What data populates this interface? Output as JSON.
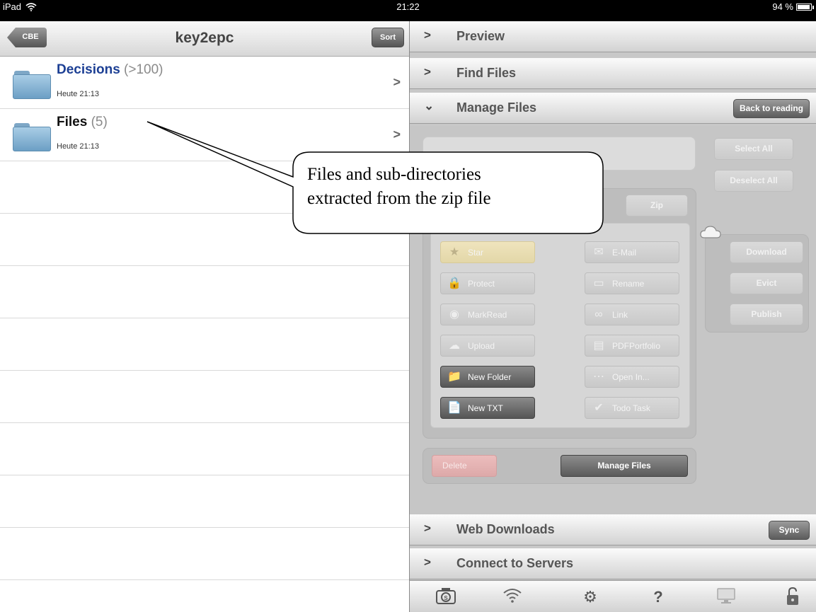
{
  "status_bar": {
    "device": "iPad",
    "time": "21:22",
    "battery": "94 %",
    "battery_level": 0.94
  },
  "left_pane": {
    "back_label": "CBE",
    "title": "key2epc",
    "sort_label": "Sort",
    "items": [
      {
        "name": "Decisions",
        "count": "(>100)",
        "date": "Heute 21:13",
        "name_color": "#1c3f94"
      },
      {
        "name": "Files",
        "count": "(5)",
        "date": "Heute 21:13",
        "name_color": "#111111"
      }
    ]
  },
  "right_pane": {
    "sections": {
      "preview": "Preview",
      "find_files": "Find Files",
      "manage_files": "Manage Files",
      "web_downloads": "Web Downloads",
      "connect_servers": "Connect to Servers"
    },
    "back_to_reading": "Back to reading",
    "sync": "Sync",
    "manage": {
      "select_all": "Select All",
      "deselect_all": "Deselect All",
      "zip": "Zip",
      "actions_left": [
        {
          "label": "Star",
          "icon": "star-icon",
          "glyph": "★"
        },
        {
          "label": "Protect",
          "icon": "lock-icon",
          "glyph": "🔒"
        },
        {
          "label": "MarkRead",
          "icon": "eye-icon",
          "glyph": "◉"
        },
        {
          "label": "Upload",
          "icon": "cloud-upload-icon",
          "glyph": "☁"
        },
        {
          "label": "New Folder",
          "icon": "new-folder-icon",
          "glyph": "📁"
        },
        {
          "label": "New TXT",
          "icon": "new-document-icon",
          "glyph": "📄"
        }
      ],
      "actions_right": [
        {
          "label": "E-Mail",
          "icon": "envelope-icon",
          "glyph": "✉"
        },
        {
          "label": "Rename",
          "icon": "rename-icon",
          "glyph": "▭"
        },
        {
          "label": "Link",
          "icon": "link-icon",
          "glyph": "∞"
        },
        {
          "label": "PDFPortfolio",
          "icon": "portfolio-icon",
          "glyph": "▤"
        },
        {
          "label": "Open In...",
          "icon": "ellipsis-icon",
          "glyph": "⋯"
        },
        {
          "label": "Todo Task",
          "icon": "checkmark-icon",
          "glyph": "✔"
        }
      ],
      "cloud_actions": [
        "Download",
        "Evict",
        "Publish"
      ],
      "delete": "Delete",
      "manage_files_button": "Manage Files"
    },
    "toolbar_icons": [
      "camera-icon",
      "wifi-icon",
      "gear-icon",
      "help-icon",
      "monitor-icon",
      "unlock-icon"
    ]
  },
  "callout": {
    "line1": "Files and sub-directories",
    "line2": "extracted from the zip file"
  }
}
